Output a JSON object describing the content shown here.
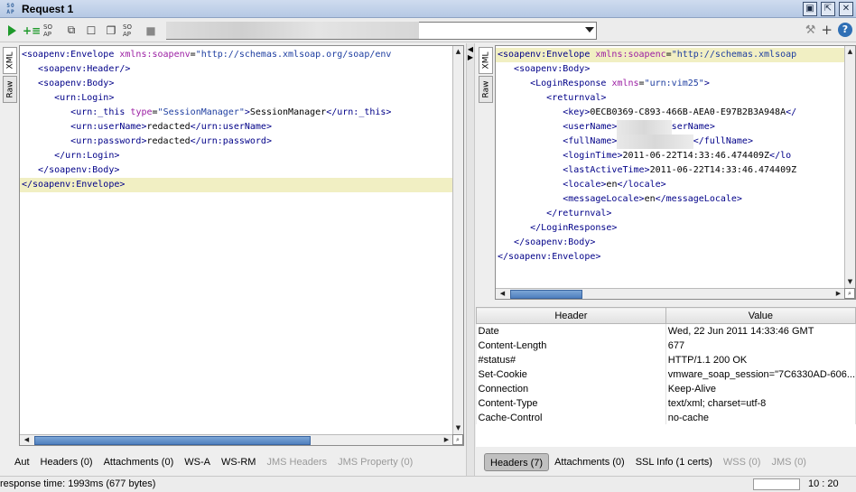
{
  "window": {
    "app_icon": "SO AP",
    "title": "Request 1",
    "buttons": [
      "restore-icon",
      "float-icon",
      "close-icon"
    ]
  },
  "toolbar": {
    "endpoint": "",
    "help": "?"
  },
  "request": {
    "tabs": [
      "XML",
      "Raw"
    ],
    "lines": [
      [
        {
          "t": "tag",
          "v": "<soapenv:Envelope "
        },
        {
          "t": "attr",
          "v": "xmlns:soapenv"
        },
        {
          "t": "txt",
          "v": "="
        },
        {
          "t": "val",
          "v": "\"http://schemas.xmlsoap.org/soap/env"
        }
      ],
      [
        {
          "t": "tag",
          "v": "   <soapenv:Header/>"
        }
      ],
      [
        {
          "t": "tag",
          "v": "   <soapenv:Body>"
        }
      ],
      [
        {
          "t": "tag",
          "v": "      <urn:Login>"
        }
      ],
      [
        {
          "t": "tag",
          "v": "         <urn:_this "
        },
        {
          "t": "attr",
          "v": "type"
        },
        {
          "t": "txt",
          "v": "="
        },
        {
          "t": "val",
          "v": "\"SessionManager\""
        },
        {
          "t": "tag",
          "v": ">"
        },
        {
          "t": "txt",
          "v": "SessionManager"
        },
        {
          "t": "tag",
          "v": "</urn:_this>"
        }
      ],
      [
        {
          "t": "tag",
          "v": "         <urn:userName>"
        },
        {
          "t": "txt",
          "v": "redacted"
        },
        {
          "t": "tag",
          "v": "</urn:userName>"
        }
      ],
      [
        {
          "t": "tag",
          "v": "         <urn:password>"
        },
        {
          "t": "txt",
          "v": "redacted"
        },
        {
          "t": "tag",
          "v": "</urn:password>"
        }
      ],
      [
        {
          "t": "tag",
          "v": "      </urn:Login>"
        }
      ],
      [
        {
          "t": "tag",
          "v": "   </soapenv:Body>"
        }
      ],
      [
        {
          "t": "tag",
          "v": "</soapenv:Envelope>"
        }
      ]
    ],
    "bottom_tabs": [
      {
        "label": "Aut",
        "enabled": true
      },
      {
        "label": "Headers (0)",
        "enabled": true
      },
      {
        "label": "Attachments (0)",
        "enabled": true
      },
      {
        "label": "WS-A",
        "enabled": true
      },
      {
        "label": "WS-RM",
        "enabled": true
      },
      {
        "label": "JMS Headers",
        "enabled": false
      },
      {
        "label": "JMS Property (0)",
        "enabled": false
      }
    ]
  },
  "response": {
    "tabs": [
      "XML",
      "Raw"
    ],
    "lines": [
      [
        {
          "t": "tag",
          "v": "<soapenv:Envelope "
        },
        {
          "t": "attr",
          "v": "xmlns:soapenc"
        },
        {
          "t": "txt",
          "v": "="
        },
        {
          "t": "val",
          "v": "\"http://schemas.xmlsoap"
        }
      ],
      [
        {
          "t": "tag",
          "v": "   <soapenv:Body>"
        }
      ],
      [
        {
          "t": "tag",
          "v": "      <LoginResponse "
        },
        {
          "t": "attr",
          "v": "xmlns"
        },
        {
          "t": "txt",
          "v": "="
        },
        {
          "t": "val",
          "v": "\"urn:vim25\""
        },
        {
          "t": "tag",
          "v": ">"
        }
      ],
      [
        {
          "t": "tag",
          "v": "         <returnval>"
        }
      ],
      [
        {
          "t": "tag",
          "v": "            <key>"
        },
        {
          "t": "txt",
          "v": "0ECB0369-C893-466B-AEA0-E97B2B3A948A"
        },
        {
          "t": "tag",
          "v": "</"
        }
      ],
      [
        {
          "t": "tag",
          "v": "            <userName>"
        },
        {
          "t": "blur",
          "v": "xxxxxxxxxx"
        },
        {
          "t": "tag",
          "v": "serName>"
        }
      ],
      [
        {
          "t": "tag",
          "v": "            <fullName>"
        },
        {
          "t": "blur",
          "v": "xxxxxxxxxxxxxx"
        },
        {
          "t": "tag",
          "v": "</fullName>"
        }
      ],
      [
        {
          "t": "tag",
          "v": "            <loginTime>"
        },
        {
          "t": "txt",
          "v": "2011-06-22T14:33:46.474409Z"
        },
        {
          "t": "tag",
          "v": "</lo"
        }
      ],
      [
        {
          "t": "tag",
          "v": "            <lastActiveTime>"
        },
        {
          "t": "txt",
          "v": "2011-06-22T14:33:46.474409Z"
        }
      ],
      [
        {
          "t": "tag",
          "v": "            <locale>"
        },
        {
          "t": "txt",
          "v": "en"
        },
        {
          "t": "tag",
          "v": "</locale>"
        }
      ],
      [
        {
          "t": "tag",
          "v": "            <messageLocale>"
        },
        {
          "t": "txt",
          "v": "en"
        },
        {
          "t": "tag",
          "v": "</messageLocale>"
        }
      ],
      [
        {
          "t": "tag",
          "v": "         </returnval>"
        }
      ],
      [
        {
          "t": "tag",
          "v": "      </LoginResponse>"
        }
      ],
      [
        {
          "t": "tag",
          "v": "   </soapenv:Body>"
        }
      ],
      [
        {
          "t": "tag",
          "v": "</soapenv:Envelope>"
        }
      ]
    ],
    "headers_table": {
      "columns": [
        "Header",
        "Value"
      ],
      "rows": [
        [
          "Date",
          "Wed, 22 Jun 2011 14:33:46 GMT"
        ],
        [
          "Content-Length",
          "677"
        ],
        [
          "#status#",
          "HTTP/1.1 200 OK"
        ],
        [
          "Set-Cookie",
          "vmware_soap_session=\"7C6330AD-606..."
        ],
        [
          "Connection",
          "Keep-Alive"
        ],
        [
          "Content-Type",
          "text/xml; charset=utf-8"
        ],
        [
          "Cache-Control",
          "no-cache"
        ]
      ]
    },
    "bottom_tabs": [
      {
        "label": "Headers (7)",
        "enabled": true,
        "selected": true
      },
      {
        "label": "Attachments (0)",
        "enabled": true
      },
      {
        "label": "SSL Info (1 certs)",
        "enabled": true
      },
      {
        "label": "WSS (0)",
        "enabled": false
      },
      {
        "label": "JMS (0)",
        "enabled": false
      }
    ]
  },
  "status": {
    "response_time": "response time: 1993ms (677 bytes)",
    "cursor": "10 : 20"
  }
}
